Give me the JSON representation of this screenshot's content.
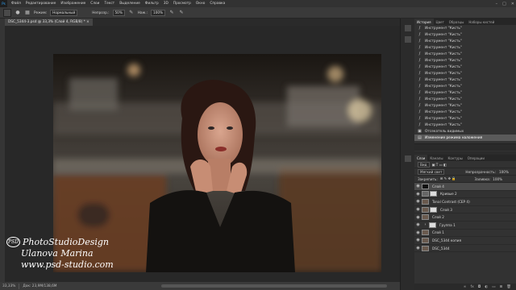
{
  "menubar": {
    "logo": "Ps",
    "items": [
      "Файл",
      "Редактирование",
      "Изображение",
      "Слои",
      "Текст",
      "Выделение",
      "Фильтр",
      "3D",
      "Просмотр",
      "Окно",
      "Справка"
    ]
  },
  "window_controls": {
    "minimize": "–",
    "maximize": "□",
    "close": "✕"
  },
  "optionsbar": {
    "mode_label": "Режим:",
    "mode_value": "Нормальный",
    "opacity_label": "Непрозр.:",
    "opacity_value": "50%",
    "flow_label": "Наж.:",
    "flow_value": "100%"
  },
  "document_tab": "DSC_5344-3.psd @ 33,3% (Слой 4, RGB/8) * ×",
  "watermark": {
    "logo": "PSD",
    "line1": "PhotoStudioDesign",
    "line2": "Ulanova Marina",
    "line3": "www.psd-studio.com"
  },
  "statusbar": {
    "zoom": "33,33%",
    "doc_size": "Док: 23,9M/138,6M"
  },
  "history_panel": {
    "tabs": [
      "История",
      "Цвет",
      "Образцы",
      "Наборы кистей"
    ],
    "active_tab": "История",
    "items": [
      "Инструмент \"Кисть\"",
      "Инструмент \"Кисть\"",
      "Инструмент \"Кисть\"",
      "Инструмент \"Кисть\"",
      "Инструмент \"Кисть\"",
      "Инструмент \"Кисть\"",
      "Инструмент \"Кисть\"",
      "Инструмент \"Кисть\"",
      "Инструмент \"Кисть\"",
      "Инструмент \"Кисть\"",
      "Инструмент \"Кисть\"",
      "Инструмент \"Кисть\"",
      "Инструмент \"Кисть\"",
      "Инструмент \"Кисть\"",
      "Инструмент \"Кисть\"",
      "Инструмент \"Кисть\"",
      "Отсекатель видимых",
      "Изменение режима наложения"
    ],
    "selected_index": 17
  },
  "layers_panel": {
    "tabs": [
      "Слои",
      "Каналы",
      "Контуры",
      "Операции"
    ],
    "active_tab": "Слои",
    "filter_label": "Вид",
    "blend_mode": "Мягкий свет",
    "opacity_label": "Непрозрачность:",
    "opacity_value": "100%",
    "lock_label": "Закрепить:",
    "fill_label": "Заливка:",
    "fill_value": "100%",
    "layers": [
      {
        "name": "Слой 4",
        "thumb": "mask",
        "selected": true
      },
      {
        "name": "Кривые 2",
        "thumb": "adj",
        "selected": false
      },
      {
        "name": "Tonal Contrast (CEP 4)",
        "thumb": "img",
        "selected": false
      },
      {
        "name": "Слой 3",
        "thumb": "img",
        "selected": false
      },
      {
        "name": "Слой 2",
        "thumb": "img",
        "selected": false
      },
      {
        "name": "Группа 1",
        "thumb": "white",
        "selected": false
      },
      {
        "name": "Слой 1",
        "thumb": "img",
        "selected": false
      },
      {
        "name": "DSC_5344 копия",
        "thumb": "img",
        "selected": false
      },
      {
        "name": "DSC_5344",
        "thumb": "img",
        "selected": false
      }
    ]
  },
  "colors": {
    "accent": "#31a8ff",
    "panel_bg": "#323232",
    "app_bg": "#282828"
  }
}
